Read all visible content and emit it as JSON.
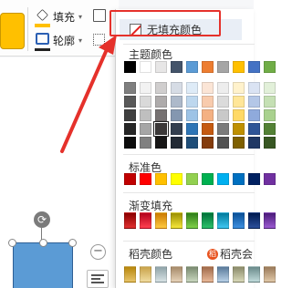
{
  "ribbon": {
    "fill_label": "填充",
    "outline_label": "轮廓",
    "dropdown_arrow": "▾"
  },
  "fill_menu": {
    "no_fill_label": "无填充颜色",
    "theme_title": "主题颜色",
    "theme_top_row": [
      "#000000",
      "#ffffff",
      "#e7e6e6",
      "#44546a",
      "#5b9bd5",
      "#ed7d31",
      "#a5a5a5",
      "#ffc000",
      "#4472c4",
      "#70ad47"
    ],
    "theme_shades": [
      [
        "#7f7f7f",
        "#f2f2f2",
        "#d0cece",
        "#d6dce5",
        "#deebf7",
        "#fbe5d6",
        "#ededed",
        "#fff2cc",
        "#dae3f3",
        "#e2f0d9"
      ],
      [
        "#595959",
        "#d9d9d9",
        "#aeabab",
        "#adb9ca",
        "#bdd7ee",
        "#f8cbad",
        "#dbdbdb",
        "#ffe699",
        "#b4c7e7",
        "#c5e0b4"
      ],
      [
        "#404040",
        "#bfbfbf",
        "#767171",
        "#8497b0",
        "#9dc3e6",
        "#f4b183",
        "#c9c9c9",
        "#ffd966",
        "#8faadc",
        "#a9d18e"
      ],
      [
        "#262626",
        "#a6a6a6",
        "#3b3838",
        "#333f50",
        "#2e75b6",
        "#c55a11",
        "#7b7b7b",
        "#bf9000",
        "#2f5597",
        "#538135"
      ],
      [
        "#0d0d0d",
        "#808080",
        "#171616",
        "#222a35",
        "#1f4e79",
        "#843c0c",
        "#525252",
        "#7f6000",
        "#203864",
        "#385723"
      ]
    ],
    "selected_swatch": "#3b3838",
    "standard_title": "标准色",
    "standard_colors": [
      "#c00000",
      "#ff0000",
      "#ffc000",
      "#ffff00",
      "#92d050",
      "#00b050",
      "#00b0f0",
      "#0070c0",
      "#002060",
      "#7030a0"
    ],
    "gradient_title": "渐变填充",
    "gradient_colors": [
      [
        "#8b0000",
        "#e03030"
      ],
      [
        "#b3001b",
        "#ff4050"
      ],
      [
        "#cc7a00",
        "#ffc940"
      ],
      [
        "#9b8f00",
        "#f5e63a"
      ],
      [
        "#2e7d1a",
        "#7fd04a"
      ],
      [
        "#00703a",
        "#2bc06a"
      ],
      [
        "#007a9c",
        "#3fc6f0"
      ],
      [
        "#0a4f96",
        "#3d8fe0"
      ],
      [
        "#001a4f",
        "#2b4f9a"
      ],
      [
        "#4a1a7a",
        "#9a5ad0"
      ]
    ],
    "daoke_title": "稻壳颜色",
    "daoke_link_label": "稻壳会",
    "daoke_icon_glyph": "稻",
    "daoke_colors": [
      [
        "#b8860b",
        "#e8c46a"
      ],
      [
        "#c9a34a",
        "#f0dca0"
      ],
      [
        "#8fa3a8",
        "#d7e2e4"
      ],
      [
        "#a68a6a",
        "#e6d2b8"
      ],
      [
        "#7a8a70",
        "#c8d6be"
      ],
      [
        "#a06a4a",
        "#e8b898"
      ],
      [
        "#5a7a9a",
        "#b8d0e6"
      ],
      [
        "#8a8a6a",
        "#d8d8b8"
      ],
      [
        "#6a8a8a",
        "#c0dada"
      ],
      [
        "#9a7a5a",
        "#e0c8a8"
      ]
    ]
  },
  "colors": {
    "highlight": "#e5312b",
    "accent_fill": "#ffc000",
    "shape_fill": "#5b9bd5"
  },
  "icons": {
    "rotate_glyph": "⟳",
    "minus_glyph": "−"
  }
}
